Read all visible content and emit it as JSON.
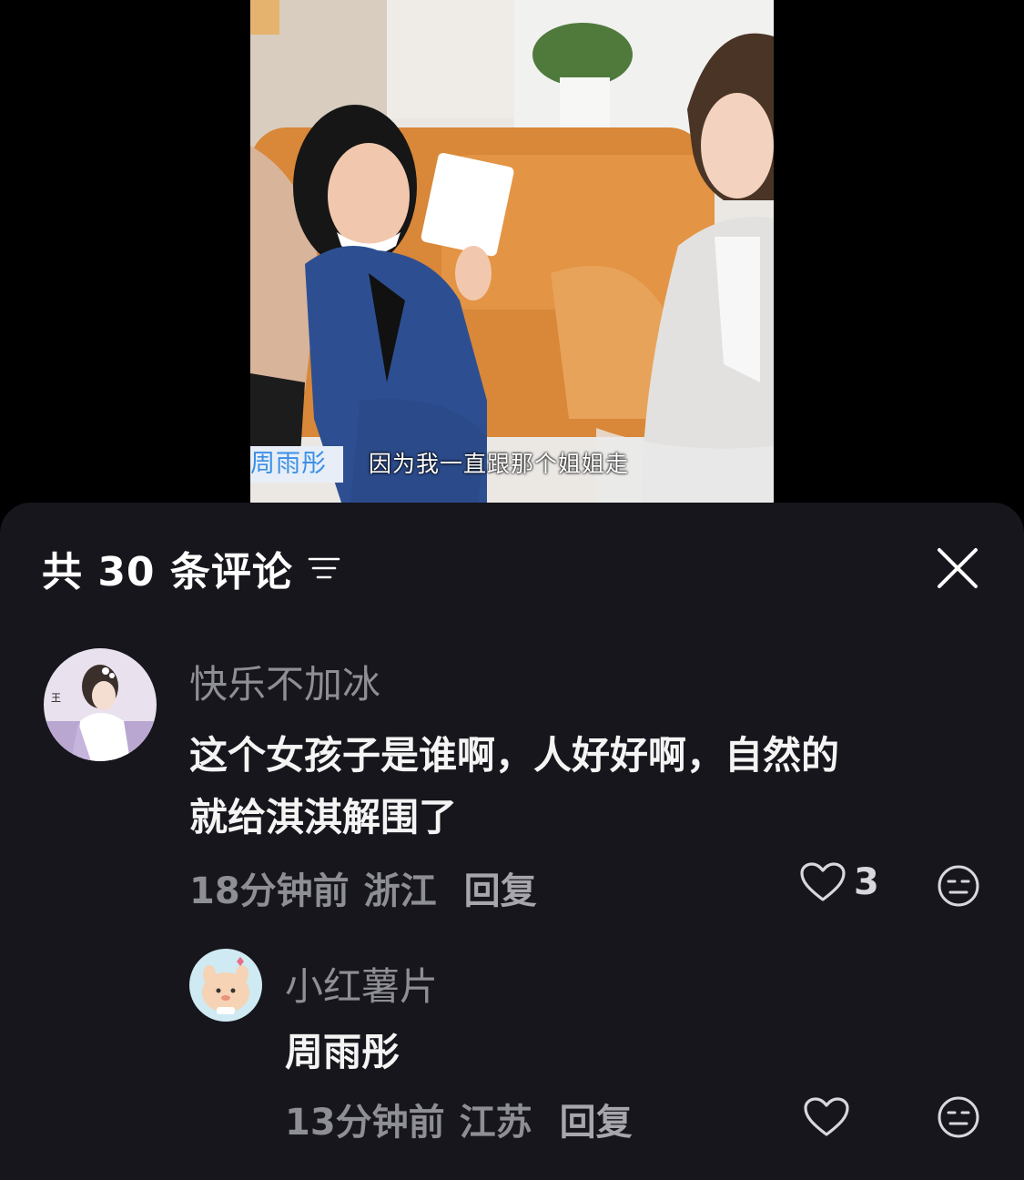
{
  "video": {
    "speaker": "周雨彤",
    "subtitle": "因为我一直跟那个姐姐走"
  },
  "comments_panel": {
    "title": "共 30 条评论",
    "sort_icon": "filter-lines-icon",
    "close_icon": "close-icon"
  },
  "comments": [
    {
      "username": "快乐不加冰",
      "text_line1": "这个女孩子是谁啊，人好好啊，自然的",
      "text_line2": "就给淇淇解围了",
      "time": "18分钟前",
      "location": "浙江",
      "reply_label": "回复",
      "likes": "3"
    },
    {
      "username": "小红薯片",
      "text_line1": "周雨彤",
      "time": "13分钟前",
      "location": "江苏",
      "reply_label": "回复"
    }
  ],
  "colors": {
    "sheet_bg": "#16161c",
    "muted": "#8e8e95",
    "accent": "#3b8fe6"
  }
}
